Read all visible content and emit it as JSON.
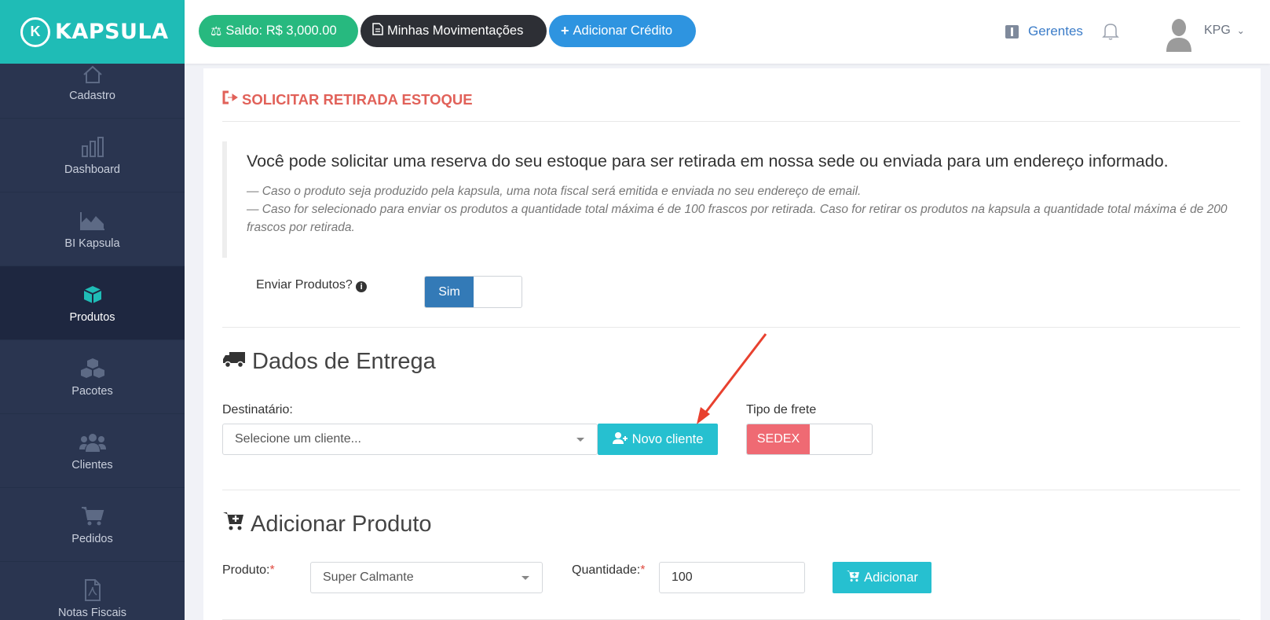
{
  "brand": {
    "name": "KAPSULA",
    "mark": "K"
  },
  "sidebar": {
    "items": [
      {
        "label": "Cadastro",
        "icon": "home-icon",
        "active": false
      },
      {
        "label": "Dashboard",
        "icon": "bar-chart-icon",
        "active": false
      },
      {
        "label": "BI Kapsula",
        "icon": "area-chart-icon",
        "active": false
      },
      {
        "label": "Produtos",
        "icon": "cube-icon",
        "active": true
      },
      {
        "label": "Pacotes",
        "icon": "cubes-icon",
        "active": false
      },
      {
        "label": "Clientes",
        "icon": "users-icon",
        "active": false
      },
      {
        "label": "Pedidos",
        "icon": "cart-icon",
        "active": false
      },
      {
        "label": "Notas Fiscais",
        "icon": "pdf-file-icon",
        "active": false
      }
    ]
  },
  "header": {
    "saldo": "Saldo: R$ 3,000.00",
    "movimentacoes": "Minhas Movimentações",
    "adicionar_credito": "Adicionar Crédito",
    "gerentes": "Gerentes",
    "user": "KPG"
  },
  "page": {
    "title": "SOLICITAR RETIRADA ESTOQUE",
    "lead": "Você pode solicitar uma reserva do seu estoque para ser retirada em nossa sede ou enviada para um endereço informado.",
    "notes": [
      "— Caso o produto seja produzido pela kapsula, uma nota fiscal será emitida e enviada no seu endereço de email.",
      "— Caso for selecionado para enviar os produtos a quantidade total máxima é de 100 frascos por retirada. Caso for retirar os produtos na kapsula a quantidade total máxima é de 200 frascos por retirada."
    ],
    "enviar_label": "Enviar Produtos?",
    "enviar_toggle": "Sim"
  },
  "entrega": {
    "title": "Dados de Entrega",
    "destinatario_label": "Destinatário:",
    "destinatario_placeholder": "Selecione um cliente...",
    "novo_cliente": "Novo cliente",
    "frete_label": "Tipo de frete",
    "frete_toggle": "SEDEX"
  },
  "produto": {
    "title": "Adicionar Produto",
    "produto_label": "Produto:",
    "produto_value": "Super Calmante",
    "quantidade_label": "Quantidade:",
    "quantidade_value": "100",
    "adicionar": "Adicionar",
    "required_mark": "*"
  },
  "colors": {
    "brand": "#1fbcb6",
    "sidebar": "#2a3550",
    "saldo": "#27b97f",
    "credito": "#2e94e0",
    "title_red": "#e16159",
    "toggle_blue": "#337ab7",
    "sedex_red": "#ef6a73",
    "info_button": "#26c0d0",
    "annotation_arrow": "#e8412f"
  }
}
